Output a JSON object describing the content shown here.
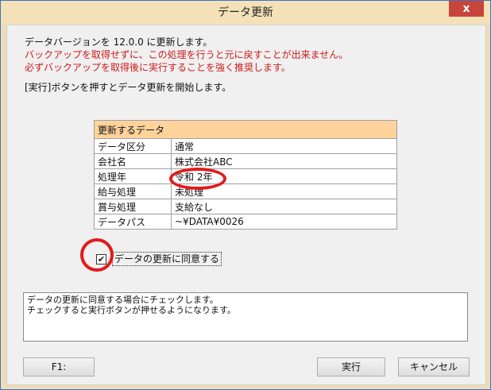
{
  "window": {
    "title": "データ更新",
    "close_glyph": "x"
  },
  "messages": {
    "line1": "データバージョンを 12.0.0 に更新します。",
    "line2": "バックアップを取得せずに、この処理を行うと元に戻すことが出来ません。",
    "line3": "必ずバックアップを取得後に実行することを強く推奨します。",
    "line4": "[実行]ボタンを押すとデータ更新を開始します。"
  },
  "data_table": {
    "header": "更新するデータ",
    "rows": [
      {
        "label": "データ区分",
        "value": "通常"
      },
      {
        "label": "会社名",
        "value": "株式会社ABC"
      },
      {
        "label": "処理年",
        "value": "令和 2年"
      },
      {
        "label": "給与処理",
        "value": "未処理"
      },
      {
        "label": "賞与処理",
        "value": "支給なし"
      },
      {
        "label": "データパス",
        "value": "~¥DATA¥0026"
      }
    ]
  },
  "agree": {
    "checked": true,
    "check_glyph": "✔",
    "label": "データの更新に同意する"
  },
  "hint": {
    "line1": "データの更新に同意する場合にチェックします。",
    "line2": "チェックすると実行ボタンが押せるようになります。"
  },
  "buttons": {
    "f1": "F1:",
    "execute": "実行",
    "cancel": "キャンセル"
  },
  "colors": {
    "red_text": "#cc1b1b",
    "table_header": "#ffd39b",
    "annotation_ring": "#e21b1b"
  }
}
